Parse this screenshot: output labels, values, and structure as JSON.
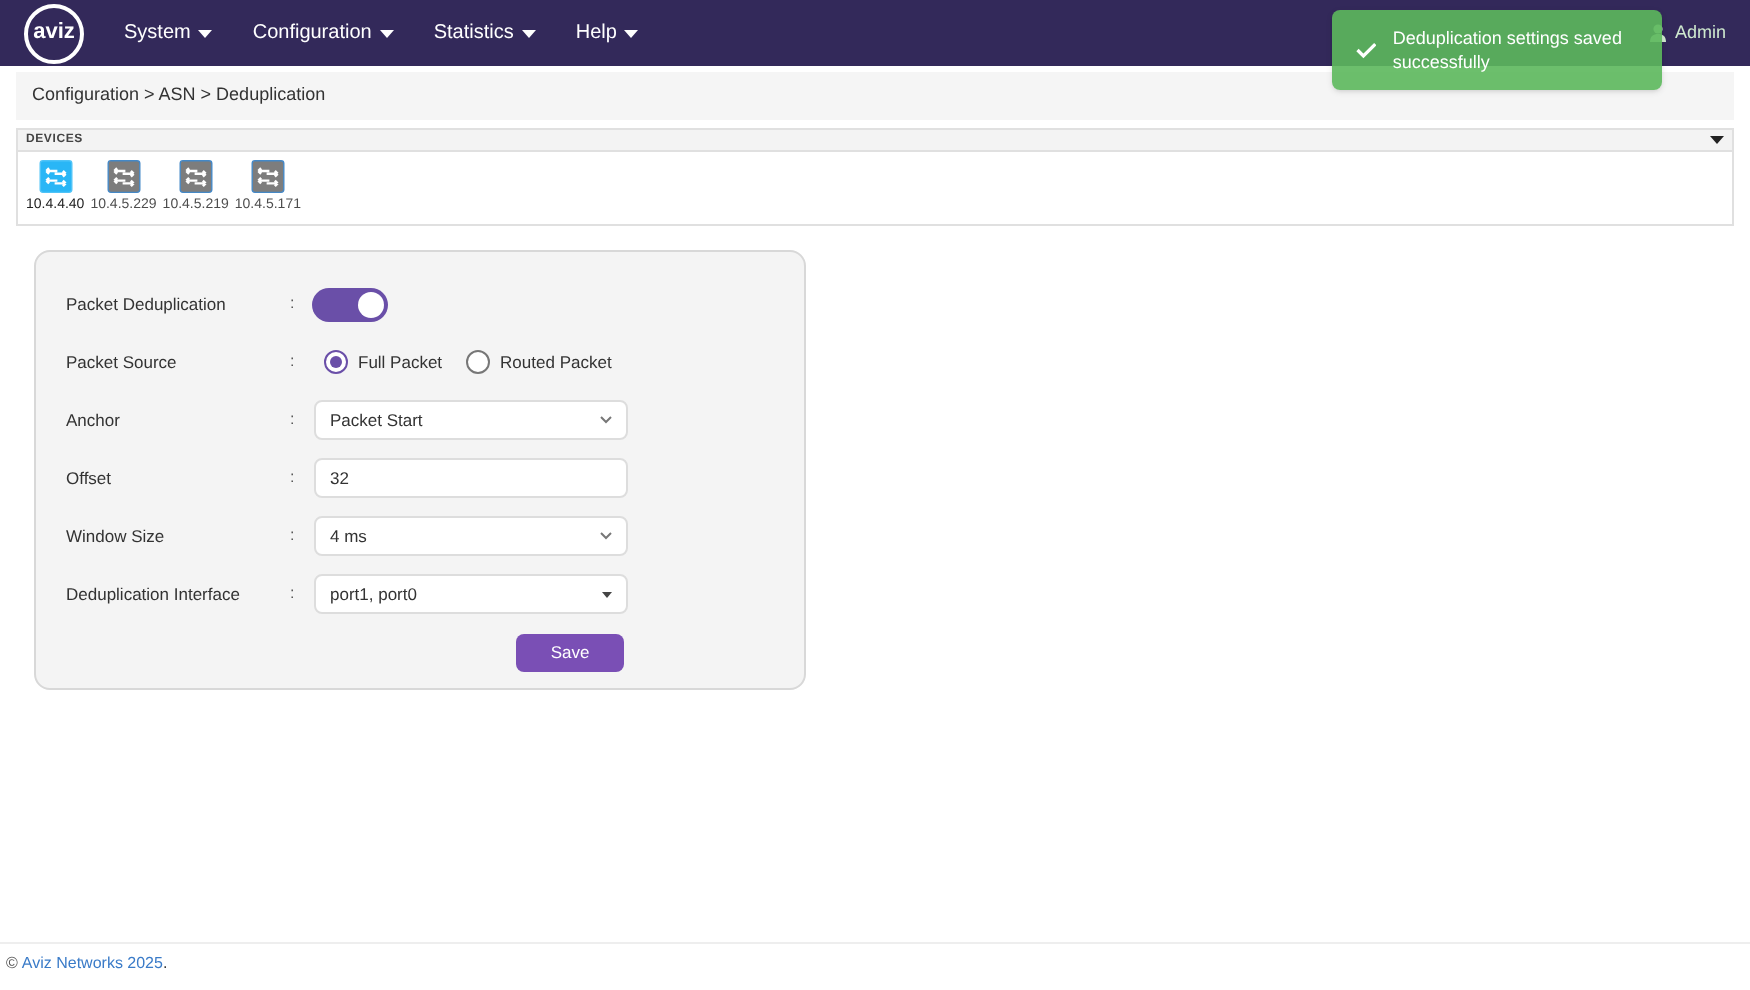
{
  "navbar": {
    "logo": "aviz",
    "menus": [
      {
        "label": "System"
      },
      {
        "label": "Configuration"
      },
      {
        "label": "Statistics"
      },
      {
        "label": "Help"
      }
    ],
    "user": "Admin"
  },
  "toast": {
    "message": "Deduplication settings saved successfully"
  },
  "breadcrumb": "Configuration > ASN > Deduplication",
  "devices": {
    "title": "DEVICES",
    "items": [
      {
        "label": "10.4.4.40",
        "selected": true
      },
      {
        "label": "10.4.5.229",
        "selected": false
      },
      {
        "label": "10.4.5.219",
        "selected": false
      },
      {
        "label": "10.4.5.171",
        "selected": false
      }
    ]
  },
  "form": {
    "rows": [
      {
        "kind": "toggle",
        "label": "Packet Deduplication",
        "separator": ":",
        "on": true
      },
      {
        "kind": "radio",
        "label": "Packet Source",
        "separator": ":",
        "options": [
          {
            "label": "Full Packet",
            "selected": true
          },
          {
            "label": "Routed Packet",
            "selected": false
          }
        ]
      },
      {
        "kind": "select",
        "label": "Anchor",
        "separator": ":",
        "value": "Packet Start"
      },
      {
        "kind": "input",
        "label": "Offset",
        "separator": ":",
        "value": "32"
      },
      {
        "kind": "select",
        "label": "Window Size",
        "separator": ":",
        "value": "4 ms"
      },
      {
        "kind": "multiselect",
        "label": "Deduplication Interface",
        "separator": ":",
        "value": "port1, port0"
      }
    ],
    "save": "Save"
  },
  "footer": {
    "prefix": "©",
    "link": "Aviz Networks 2025",
    "suffix": "."
  }
}
